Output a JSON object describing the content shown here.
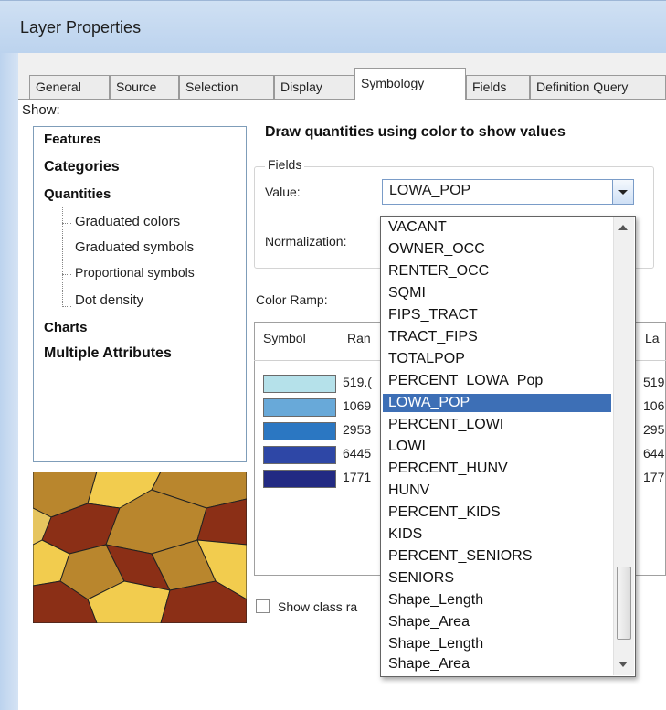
{
  "window": {
    "title": "Layer Properties"
  },
  "tabs": [
    {
      "label": "General"
    },
    {
      "label": "Source"
    },
    {
      "label": "Selection"
    },
    {
      "label": "Display"
    },
    {
      "label": "Symbology"
    },
    {
      "label": "Fields"
    },
    {
      "label": "Definition Query"
    }
  ],
  "active_tab": "Symbology",
  "show": {
    "label": "Show:",
    "items": [
      {
        "label": "Features"
      },
      {
        "label": "Categories"
      },
      {
        "label": "Quantities"
      },
      {
        "label": "Graduated colors"
      },
      {
        "label": "Graduated symbols"
      },
      {
        "label": "Proportional symbols"
      },
      {
        "label": "Dot density"
      },
      {
        "label": "Charts"
      },
      {
        "label": "Multiple Attributes"
      }
    ]
  },
  "main": {
    "heading": "Draw quantities using color to show values",
    "fields_legend": "Fields",
    "value_label": "Value:",
    "value_selected": "LOWA_POP",
    "normalization_label": "Normalization:",
    "color_ramp_label": "Color Ramp:",
    "columns": {
      "symbol": "Symbol",
      "range": "Ran",
      "label": "La"
    },
    "classes": [
      {
        "color": "#b5e1ea",
        "range": "519.(",
        "label": "519"
      },
      {
        "color": "#68a9d9",
        "range": "1069",
        "label": "106"
      },
      {
        "color": "#2b77c2",
        "range": "2953",
        "label": "295"
      },
      {
        "color": "#2e47a6",
        "range": "6445",
        "label": "644"
      },
      {
        "color": "#222a83",
        "range": "1771",
        "label": "177"
      }
    ],
    "show_class_label": "Show class ra"
  },
  "dropdown": {
    "options": [
      "VACANT",
      "OWNER_OCC",
      "RENTER_OCC",
      "SQMI",
      "FIPS_TRACT",
      "TRACT_FIPS",
      "TOTALPOP",
      "PERCENT_LOWA_Pop",
      "LOWA_POP",
      "PERCENT_LOWI",
      "LOWI",
      "PERCENT_HUNV",
      "HUNV",
      "PERCENT_KIDS",
      "KIDS",
      "PERCENT_SENIORS",
      "SENIORS",
      "Shape_Length",
      "Shape_Area",
      "Shape_Length",
      "Shape_Area"
    ],
    "selected_index": 8
  },
  "colors": {
    "selection": "#3d6fb6",
    "map_dark": "#8b2f16",
    "map_mid": "#b9862d",
    "map_light": "#f2cc4e"
  }
}
